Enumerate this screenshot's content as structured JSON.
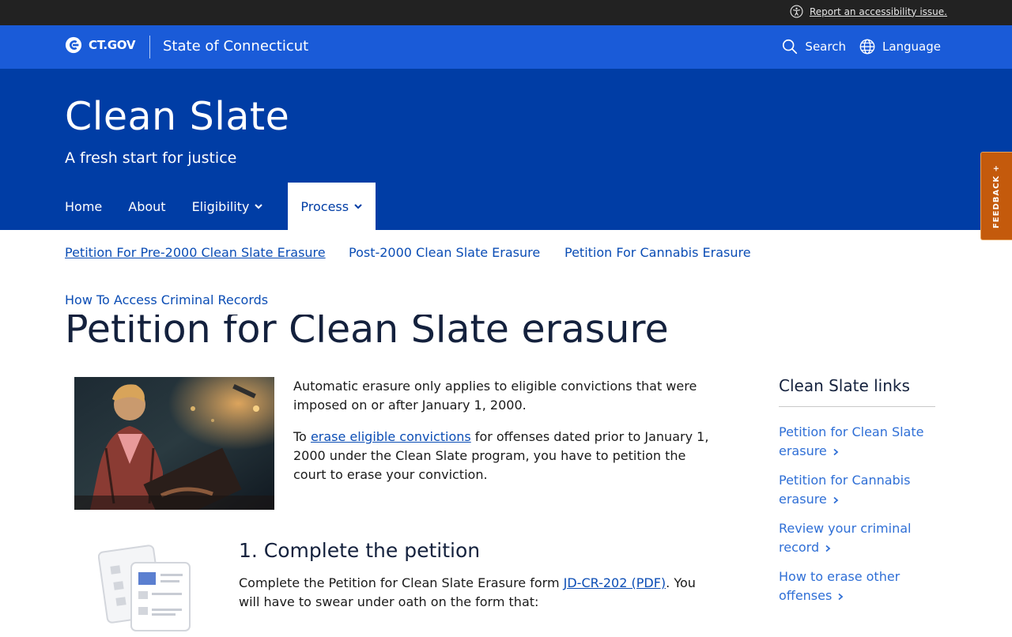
{
  "utility": {
    "accessibility_link": "Report an accessibility issue."
  },
  "header": {
    "brand": "CT.GOV",
    "site_name": "State of Connecticut",
    "search_label": "Search",
    "language_label": "Language"
  },
  "agency": {
    "title": "Clean Slate",
    "subtitle": "A fresh start for justice"
  },
  "nav": {
    "items": [
      {
        "label": "Home"
      },
      {
        "label": "About"
      },
      {
        "label": "Eligibility"
      },
      {
        "label": "Process"
      }
    ],
    "active": "Process"
  },
  "subnav": {
    "items": [
      {
        "label": "Petition For Pre-2000 Clean Slate Erasure"
      },
      {
        "label": "Post-2000 Clean Slate Erasure"
      },
      {
        "label": "Petition For Cannabis Erasure"
      },
      {
        "label": "How To Access Criminal Records"
      }
    ]
  },
  "feedback": {
    "label": "FEEDBACK +"
  },
  "page": {
    "title": "Petition for Clean Slate erasure",
    "intro_p1": "Automatic erasure only applies to eligible convictions that were imposed on or after January 1, 2000.",
    "intro_p2_prefix": "To ",
    "intro_p2_link": "erase eligible convictions",
    "intro_p2_suffix": " for offenses dated prior to January 1, 2000 under the Clean Slate program, you have to petition the court to erase your conviction.",
    "step1_heading": "1. Complete the petition",
    "step1_prefix": "Complete the Petition for Clean Slate Erasure form ",
    "step1_link": "JD-CR-202 (PDF)",
    "step1_suffix": ". You will have to swear under oath on the form that:"
  },
  "sidebar": {
    "heading": "Clean Slate links",
    "links": [
      {
        "label": "Petition for Clean Slate erasure"
      },
      {
        "label": "Petition for Cannabis erasure"
      },
      {
        "label": "Review your criminal record"
      },
      {
        "label": "How to erase other offenses"
      }
    ]
  },
  "colors": {
    "utility_bar": "#222222",
    "global_header": "#1a5bd8",
    "agency_hero": "#003da5",
    "link": "#0b4db5",
    "feedback": "#c45a0c"
  }
}
